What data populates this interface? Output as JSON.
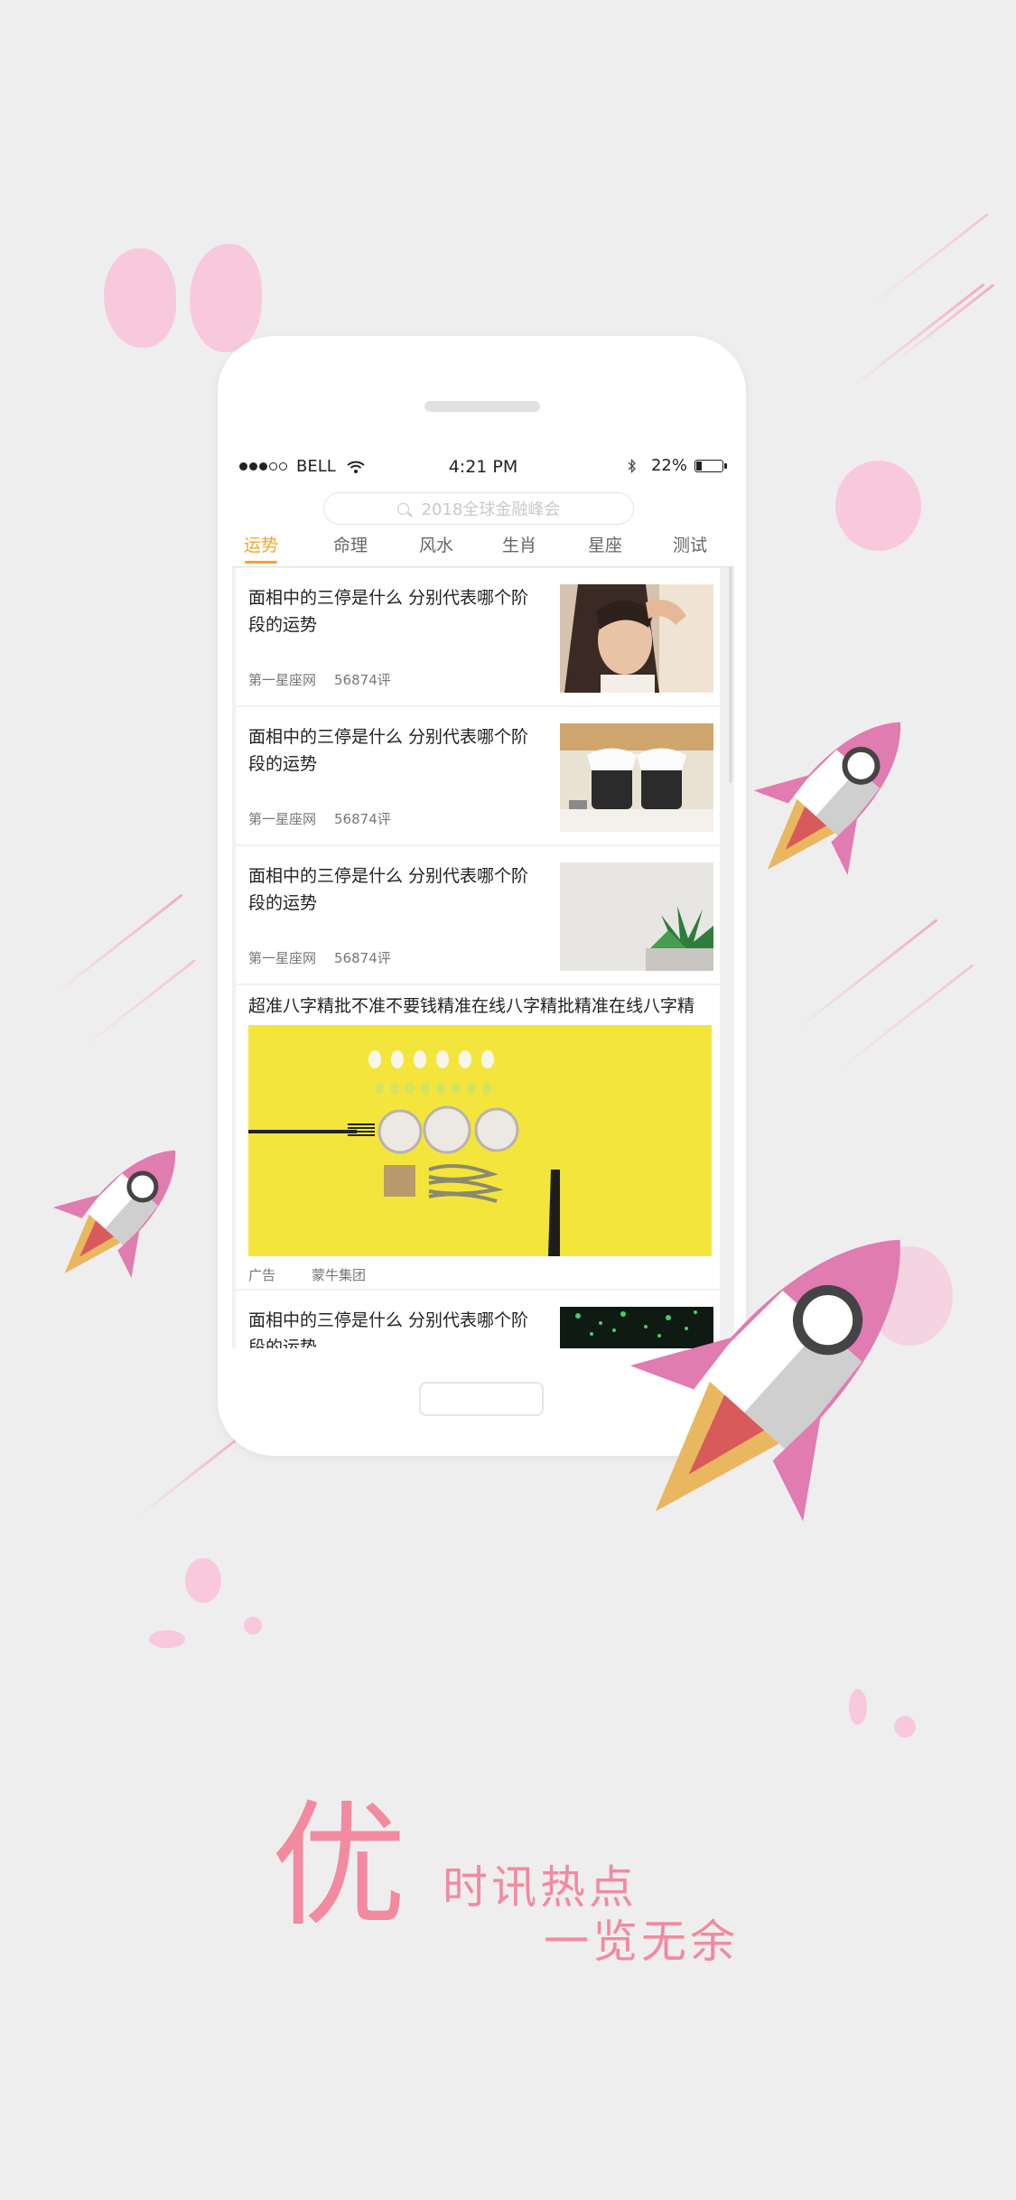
{
  "status_bar": {
    "carrier": "BELL",
    "time": "4:21 PM",
    "battery_percent": "22%",
    "battery_level": 0.22,
    "icons": [
      "signal-dots-icon",
      "wifi-icon",
      "bluetooth-icon",
      "battery-icon"
    ]
  },
  "search": {
    "placeholder": "2018全球金融峰会",
    "icon": "search-icon"
  },
  "tabs": [
    {
      "label": "运势",
      "active": true
    },
    {
      "label": "命理",
      "active": false
    },
    {
      "label": "风水",
      "active": false
    },
    {
      "label": "生肖",
      "active": false
    },
    {
      "label": "星座",
      "active": false
    },
    {
      "label": "测试",
      "active": false
    }
  ],
  "feed": [
    {
      "title": "面相中的三停是什么 分别代表哪个阶段的运势",
      "source": "第一星座网",
      "comments": "56874评",
      "image": "woman-portrait-photo"
    },
    {
      "title": "面相中的三停是什么 分别代表哪个阶段的运势",
      "source": "第一星座网",
      "comments": "56874评",
      "image": "jars-photo"
    },
    {
      "title": "面相中的三停是什么 分别代表哪个阶段的运势",
      "source": "第一星座网",
      "comments": "56874评",
      "image": "succulent-plant-photo"
    },
    {
      "title": "超准八字精批不准不要钱精准在线八字精批精准在线八字精",
      "ad_label": "广告",
      "advertiser": "蒙牛集团",
      "image": "food-flatlay-photo"
    },
    {
      "title": "面相中的三停是什么 分别代表哪个阶段的运势",
      "image": "green-sparkle-photo"
    }
  ],
  "promo": {
    "big_char": "优",
    "line1": "时讯热点",
    "line2": "一览无余",
    "color": "#f28aa0"
  },
  "colors": {
    "accent": "#f3a62b",
    "background": "#efeeef",
    "rocket_pink": "#e07cb0",
    "rocket_flame": "#e8b75f"
  }
}
